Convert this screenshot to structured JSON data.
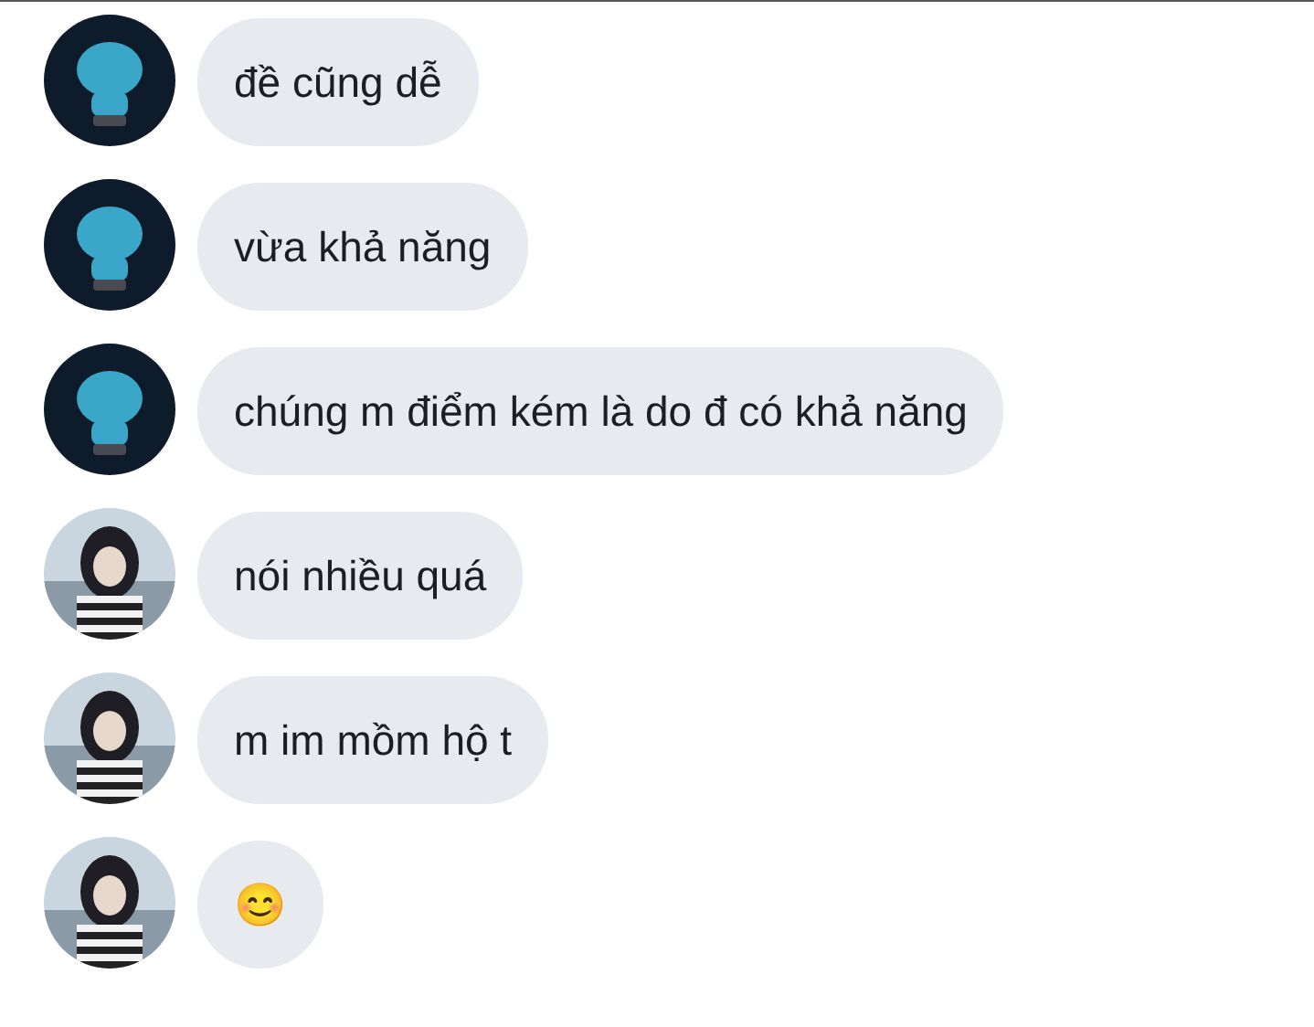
{
  "messages": [
    {
      "avatar": {
        "kind": "dark"
      },
      "text": "đề cũng dễ"
    },
    {
      "avatar": {
        "kind": "dark"
      },
      "text": "vừa khả năng"
    },
    {
      "avatar": {
        "kind": "dark"
      },
      "text": "chúng m điểm kém là do đ có khả năng"
    },
    {
      "avatar": {
        "kind": "light"
      },
      "text": "nói nhiều quá"
    },
    {
      "avatar": {
        "kind": "light"
      },
      "text": "m im mồm hộ t"
    },
    {
      "avatar": {
        "kind": "light"
      },
      "text": "😊"
    }
  ]
}
